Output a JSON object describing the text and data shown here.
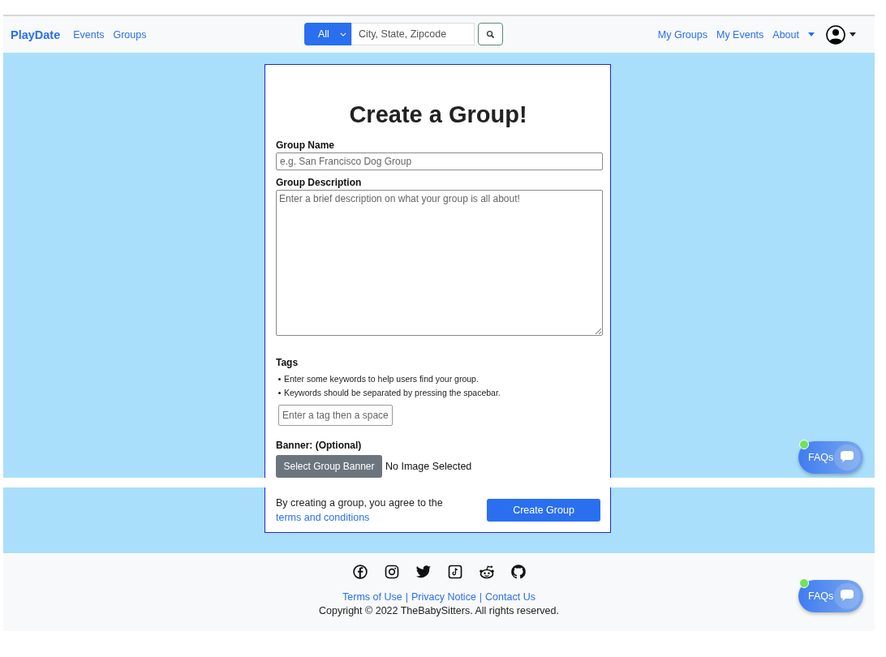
{
  "navbar": {
    "brand": "PlayDate",
    "links": [
      "Events",
      "Groups"
    ],
    "search": {
      "category": "All",
      "placeholder": "City, State, Zipcode"
    },
    "right_links": [
      "My Groups",
      "My Events"
    ],
    "about": "About"
  },
  "form": {
    "title": "Create a Group!",
    "group_name": {
      "label": "Group Name",
      "placeholder": "e.g. San Francisco Dog Group"
    },
    "group_description": {
      "label": "Group Description",
      "placeholder": "Enter a brief description on what your group is all about!"
    },
    "tags": {
      "label": "Tags",
      "hints": [
        "Enter some keywords to help users find your group.",
        "Keywords should be separated by pressing the spacebar."
      ],
      "placeholder": "Enter a tag then a space"
    },
    "banner": {
      "label": "Banner: (Optional)",
      "button": "Select Group Banner",
      "status": "No Image Selected"
    },
    "agreement": {
      "text": "By creating a group, you agree to the ",
      "link": "terms and conditions"
    },
    "submit": "Create Group"
  },
  "footer": {
    "links": [
      "Terms of Use",
      "Privacy Notice",
      "Contact Us"
    ],
    "separator": "|",
    "copyright": "Copyright © 2022 TheBabySitters. All rights reserved."
  },
  "faq_buttons": [
    {
      "label": "FAQs"
    },
    {
      "label": "FAQs"
    }
  ]
}
